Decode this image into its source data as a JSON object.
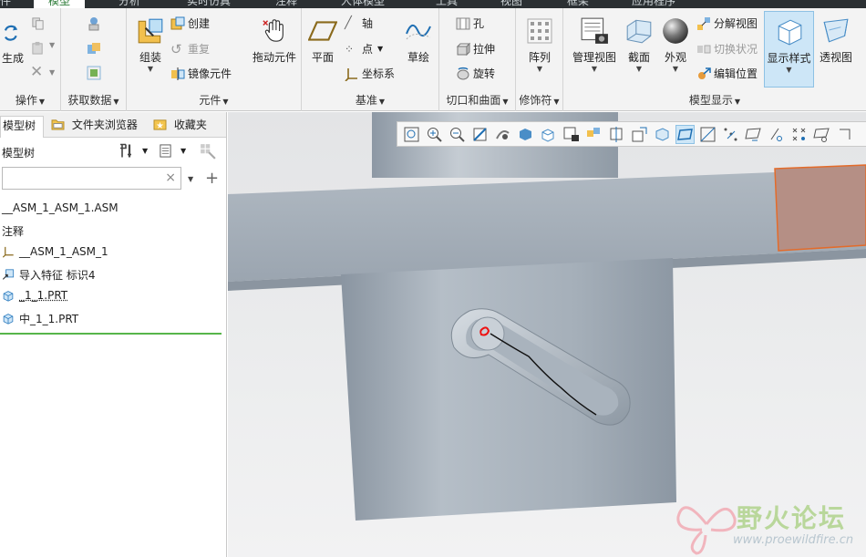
{
  "tabs": [
    "件",
    "模型",
    "分析",
    "实时仿真",
    "注释",
    "人体模型",
    "工具",
    "视图",
    "框架",
    "应用程序"
  ],
  "ribbon": {
    "operations": {
      "label": "操作",
      "regenerate": "生成"
    },
    "get_data": {
      "label": "获取数据"
    },
    "component": {
      "label": "元件",
      "assemble": "组装",
      "create": "创建",
      "repeat": "重复",
      "mirror": "镜像元件",
      "drag": "拖动元件"
    },
    "datum": {
      "label": "基准",
      "plane": "平面",
      "axis": "轴",
      "point": "点",
      "csys": "坐标系",
      "sketch": "草绘"
    },
    "cut_surface": {
      "label": "切口和曲面",
      "hole": "孔",
      "extrude": "拉伸",
      "revolve": "旋转"
    },
    "modifiers": {
      "label": "修饰符",
      "pattern": "阵列"
    },
    "model_display": {
      "label": "模型显示",
      "manage_views": "管理视图",
      "section": "截面",
      "appearance": "外观",
      "explode": "分解视图",
      "toggle_status": "切换状况",
      "edit_position": "编辑位置",
      "display_style": "显示样式",
      "perspective": "透视图"
    }
  },
  "panel": {
    "tabs": [
      "模型树",
      "文件夹浏览器",
      "收藏夹"
    ],
    "tree_title": "模型树",
    "search_placeholder": "",
    "search_clear": "×",
    "items": [
      "__ASM_1_ASM_1.ASM",
      "注释",
      "__ASM_1_ASM_1",
      "导入特征 标识4",
      "_1_1.PRT",
      "中_1_1.PRT"
    ]
  },
  "watermark": {
    "name": "野火论坛",
    "url": "www.proewildfire.cn"
  },
  "colors": {
    "accent_green": "#2a7a35",
    "selection_blue": "#cde6f7",
    "model_gray": "#9ea8b3"
  }
}
